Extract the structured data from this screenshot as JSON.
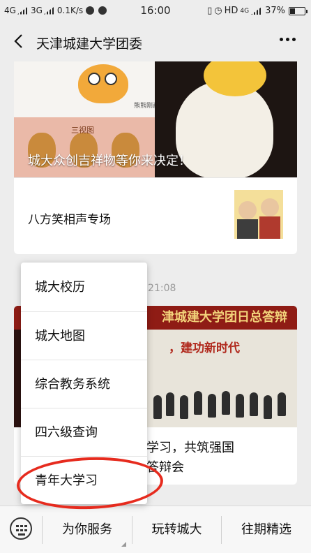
{
  "status_bar": {
    "network_1": "4G",
    "network_2": "3G",
    "speed": "0.1K/s",
    "time": "16:00",
    "hd_label": "HD",
    "network_3": "4G",
    "battery": "37%"
  },
  "header": {
    "title": "天津城建大学团委",
    "back_icon": "chevron-left-icon",
    "more_icon": "more-icon"
  },
  "feed": {
    "card1": {
      "overlay_text": "城大众创吉祥物等你来决定！",
      "image_label": "三视图",
      "row_title": "八方笑相声专场"
    },
    "timestamp": "天 21:08",
    "card2": {
      "banner": "津城建大学团日总答辩",
      "slogan": "，建功新时代",
      "caption_line1": "学习，共筑强国",
      "caption_line2": "答辩会"
    }
  },
  "menu": {
    "items": [
      {
        "label": "城大校历"
      },
      {
        "label": "城大地图"
      },
      {
        "label": "综合教务系统"
      },
      {
        "label": "四六级查询"
      },
      {
        "label": "青年大学习"
      }
    ],
    "highlight_color": "#e62b1e"
  },
  "bottom_bar": {
    "keyboard_icon": "keyboard-icon",
    "tabs": [
      {
        "label": "为你服务"
      },
      {
        "label": "玩转城大"
      },
      {
        "label": "往期精选"
      }
    ]
  }
}
